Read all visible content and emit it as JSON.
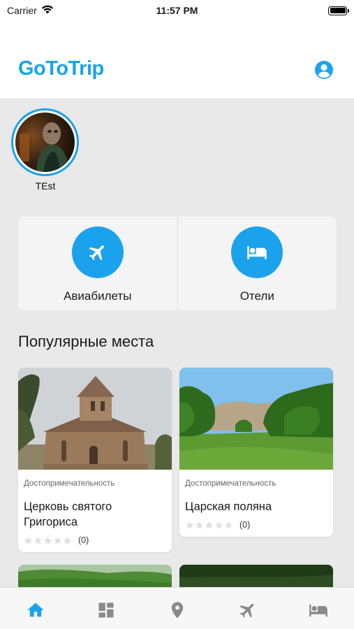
{
  "status_bar": {
    "carrier": "Carrier",
    "time": "11:57 PM",
    "battery_level": 1.0
  },
  "header": {
    "title": "GoToTrip",
    "profile_icon": "account-circle-icon"
  },
  "stories": [
    {
      "label": "TEst"
    }
  ],
  "categories": [
    {
      "label": "Авиабилеты",
      "icon": "airplane-icon"
    },
    {
      "label": "Отели",
      "icon": "hotel-bed-icon"
    }
  ],
  "popular": {
    "title": "Популярные места",
    "places": [
      {
        "category": "Достопримечательность",
        "name": "Церковь святого Григориса",
        "rating": 0,
        "rating_count": "(0)"
      },
      {
        "category": "Достопримечательность",
        "name": "Царская поляна",
        "rating": 0,
        "rating_count": "(0)"
      }
    ]
  },
  "tab_bar": {
    "active_index": 0,
    "tabs": [
      {
        "icon": "home-icon"
      },
      {
        "icon": "dashboard-icon"
      },
      {
        "icon": "location-pin-icon"
      },
      {
        "icon": "airplane-icon"
      },
      {
        "icon": "hotel-bed-icon"
      }
    ]
  },
  "colors": {
    "accent": "#1aa3ec",
    "inactive_icon": "#8a8a8a",
    "star_empty": "#e0e0e0"
  }
}
